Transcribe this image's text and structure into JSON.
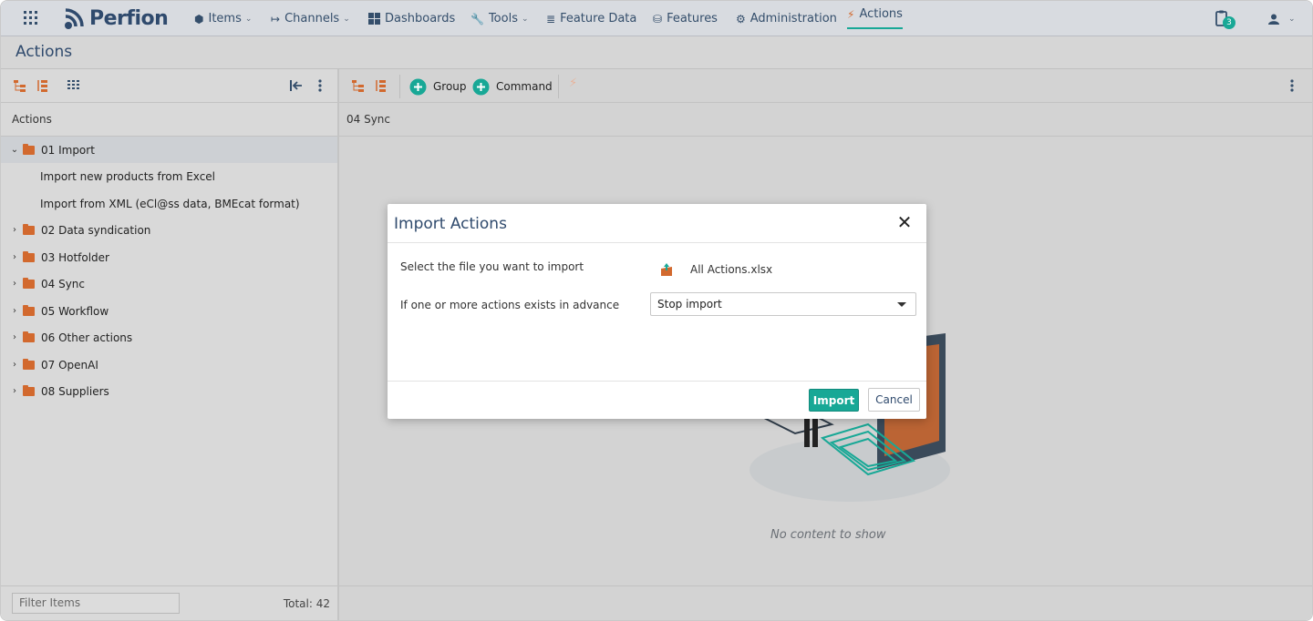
{
  "nav": {
    "items_label": "Items",
    "channels_label": "Channels",
    "dashboards_label": "Dashboards",
    "tools_label": "Tools",
    "feature_data_label": "Feature Data",
    "features_label": "Features",
    "administration_label": "Administration",
    "actions_label": "Actions",
    "logo_text": "Perfion",
    "notification_count": "3",
    "active_color": "#18a896"
  },
  "page": {
    "title": "Actions"
  },
  "left_panel": {
    "column_header": "Actions",
    "tree": [
      {
        "label": "01 Import",
        "expanded": true,
        "children": [
          "Import new products from Excel",
          "Import from XML (eCl@ss data, BMEcat format)"
        ]
      },
      {
        "label": "02 Data syndication"
      },
      {
        "label": "03 Hotfolder"
      },
      {
        "label": "04 Sync"
      },
      {
        "label": "05 Workflow"
      },
      {
        "label": "06 Other actions"
      },
      {
        "label": "07 OpenAI"
      },
      {
        "label": "08 Suppliers"
      }
    ],
    "filter_placeholder": "Filter Items",
    "total": "Total: 42"
  },
  "right_panel": {
    "group_label": "Group",
    "command_label": "Command",
    "column_header": "04 Sync",
    "empty_text": "No content to show"
  },
  "modal": {
    "title": "Import Actions",
    "file_label": "Select the file you want to import",
    "file_name": "All Actions.xlsx",
    "exists_label": "If one or more actions exists in advance",
    "exists_value": "Stop import",
    "import_label": "Import",
    "cancel_label": "Cancel"
  }
}
